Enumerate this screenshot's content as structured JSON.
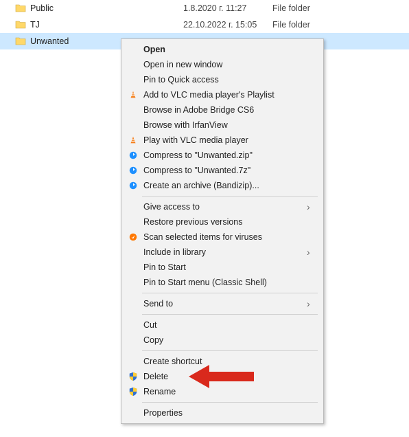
{
  "files": [
    {
      "name": "Public",
      "date": "1.8.2020 г. 11:27",
      "type": "File folder"
    },
    {
      "name": "TJ",
      "date": "22.10.2022 г. 15:05",
      "type": "File folder"
    },
    {
      "name": "Unwanted",
      "date": "",
      "type": ""
    }
  ],
  "menu": {
    "open": "Open",
    "openNew": "Open in new window",
    "pinQuick": "Pin to Quick access",
    "vlcAdd": "Add to VLC media player's Playlist",
    "bridge": "Browse in Adobe Bridge CS6",
    "irfan": "Browse with IrfanView",
    "vlcPlay": "Play with VLC media player",
    "zip": "Compress to \"Unwanted.zip\"",
    "sevenZ": "Compress to \"Unwanted.7z\"",
    "bandi": "Create an archive (Bandizip)...",
    "giveAccess": "Give access to",
    "restore": "Restore previous versions",
    "scan": "Scan selected items for viruses",
    "includeLib": "Include in library",
    "pinStart": "Pin to Start",
    "pinClassic": "Pin to Start menu (Classic Shell)",
    "sendTo": "Send to",
    "cut": "Cut",
    "copy": "Copy",
    "shortcut": "Create shortcut",
    "delete": "Delete",
    "rename": "Rename",
    "props": "Properties"
  }
}
